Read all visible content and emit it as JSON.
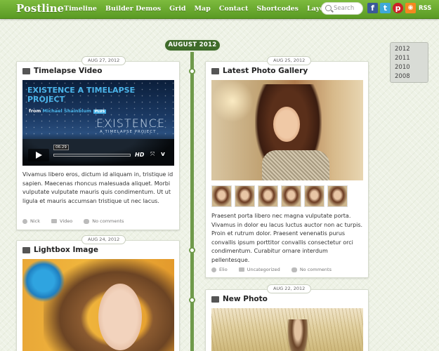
{
  "site": {
    "logo": "Postline",
    "nav": [
      "Timeline",
      "Builder Demos",
      "Grid",
      "Map",
      "Contact",
      "Shortcodes",
      "Layouts"
    ],
    "search_placeholder": "Search",
    "social": {
      "facebook": "f",
      "twitter": "t",
      "pinterest": "p",
      "rss_glyph": "◉",
      "rss_label": "RSS"
    }
  },
  "timeline": {
    "month": "AUGUST 2012",
    "years": [
      "2012",
      "2011",
      "2010",
      "2008"
    ]
  },
  "posts": [
    {
      "date": "AUG 27, 2012",
      "title": "Timelapse Video",
      "video": {
        "headline": "EXISTENCE A TIMELAPSE PROJECT",
        "from": "from",
        "author": "Michael Shainblum",
        "plus": "PLUS",
        "big_title": "EXISTENCE",
        "subtitle": "A TIMELAPSE PROJECT",
        "time": "06:29",
        "hd": "HD",
        "expand_glyph": "⤧",
        "vimeo": "v"
      },
      "excerpt": "Vivamus libero eros, dictum id aliquam in, tristique id sapien. Maecenas rhoncus malesuada aliquet. Morbi vulputate vulputate mauris quis condimentum. Ut ut ligula et mauris accumsan tristique ut nec lacus.",
      "author": "Nick",
      "category": "Video",
      "comments": "No comments"
    },
    {
      "date": "AUG 25, 2012",
      "title": "Latest Photo Gallery",
      "excerpt": "Praesent porta libero nec magna vulputate porta. Vivamus in dolor eu lacus luctus auctor non ac turpis. Proin et rutrum dolor. Praesent venenatis purus convallis ipsum porttitor convallis consectetur orci condimentum. Curabitur ornare interdum pellentesque.",
      "author": "Elio",
      "category": "Uncategorized",
      "comments": "No comments"
    },
    {
      "date": "AUG 24, 2012",
      "title": "Lightbox Image"
    },
    {
      "date": "AUG 22, 2012",
      "title": "New Photo"
    }
  ]
}
